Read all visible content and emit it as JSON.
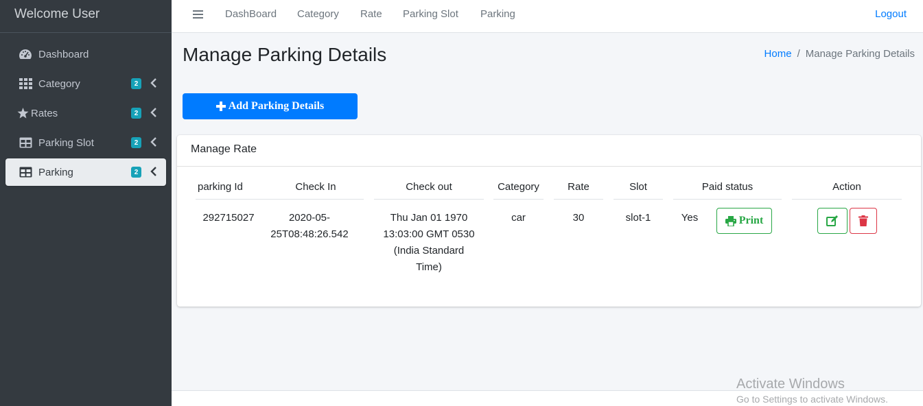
{
  "sidebar": {
    "brand": "Welcome User",
    "items": [
      {
        "label": "Dashboard",
        "icon": "tachometer-icon",
        "badge": ""
      },
      {
        "label": "Category",
        "icon": "grid-icon",
        "badge": "2"
      },
      {
        "label": "Rates",
        "icon": "star-icon",
        "badge": "2"
      },
      {
        "label": "Parking Slot",
        "icon": "table-icon",
        "badge": "2"
      },
      {
        "label": "Parking",
        "icon": "table-icon",
        "badge": "2",
        "active": true
      }
    ]
  },
  "topbar": {
    "links": [
      "DashBoard",
      "Category",
      "Rate",
      "Parking Slot",
      "Parking"
    ],
    "logout": "Logout"
  },
  "header": {
    "title": "Manage Parking Details",
    "breadcrumb_home": "Home",
    "breadcrumb_sep": "/",
    "breadcrumb_current": "Manage Parking Details"
  },
  "add_button": {
    "label": "Add Parking Details",
    "icon": "plus-icon"
  },
  "card": {
    "title": "Manage Rate",
    "columns": [
      "parking Id",
      "Check In",
      "Check out",
      "Category",
      "Rate",
      "Slot",
      "Paid status",
      "Action"
    ],
    "rows": [
      {
        "parking_id": "292715027",
        "check_in_l1": "2020-05-",
        "check_in_l2": "25T08:48:26.542",
        "check_out_l1": "Thu Jan 01 1970",
        "check_out_l2": "13:03:00 GMT 0530",
        "check_out_l3": "(India Standard",
        "check_out_l4": "Time)",
        "category": "car",
        "rate": "30",
        "slot": "slot-1",
        "paid": "Yes",
        "print_label": "Print"
      }
    ]
  },
  "watermark": {
    "title": "Activate Windows",
    "subtitle": "Go to Settings to activate Windows."
  },
  "colors": {
    "sidebar_bg": "#343a40",
    "primary": "#007bff",
    "success": "#28a745",
    "danger": "#dc3545",
    "badge": "#17a2b8"
  }
}
